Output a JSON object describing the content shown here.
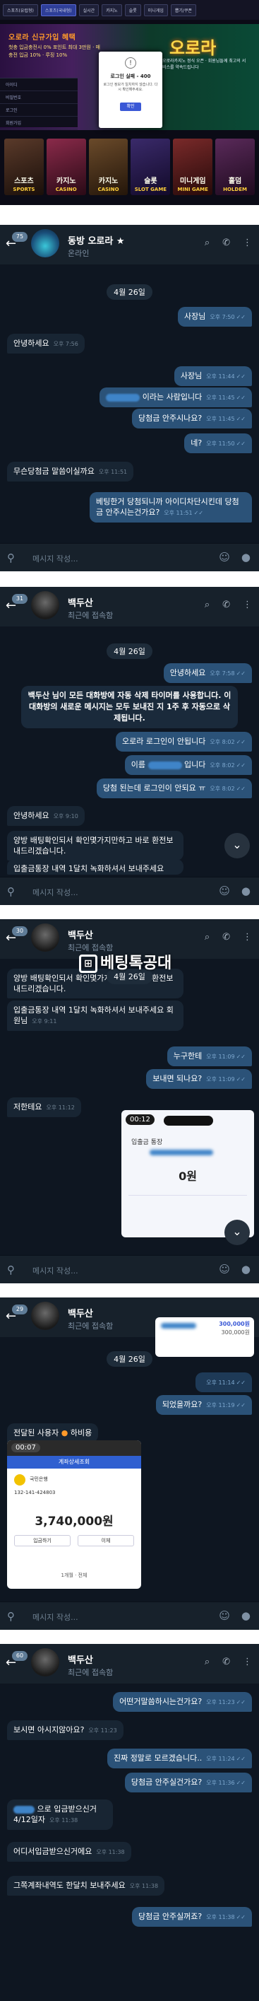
{
  "site": {
    "nav": [
      "스포츠(유럽형)",
      "스포츠(국내형)",
      "실시간",
      "카지노",
      "슬롯",
      "미니게임",
      "뽑기/쿠폰"
    ],
    "banner_title": "오로라 신규가입 혜택",
    "banner_sub": "첫충 입금충전시 0% 포인트 최대 3만원 · 매충전 입금 10% · 루징 10%",
    "brand": "오로라",
    "brand_sub": "오로라카지노 정식 오픈 · 회원님들께 최고의 서비스를 약속드립니다",
    "login_rows": [
      "아이디",
      "비밀번호",
      "로그인",
      "회원가입"
    ],
    "modal": {
      "icon": "!",
      "title": "로그인 실패 - 400",
      "body": "로그인 정보가 일치하지 않습니다. 다시 확인해주세요.",
      "ok": "확인"
    },
    "games": [
      {
        "name": "SPORTS",
        "sub": "스포츠"
      },
      {
        "name": "CASINO",
        "sub": "카지노"
      },
      {
        "name": "CASINO",
        "sub": "카지노"
      },
      {
        "name": "SLOT GAME",
        "sub": "슬롯"
      },
      {
        "name": "MINI GAME",
        "sub": "미니게임"
      },
      {
        "name": "HOLDEM",
        "sub": "홀덤"
      }
    ]
  },
  "panel1": {
    "badge": "75",
    "name": "동방 오로라 ★",
    "status": "온라인",
    "date": "4월 26일",
    "messages": [
      {
        "dir": "out",
        "text": "사장님",
        "time": "오후 7:50"
      },
      {
        "dir": "in",
        "text": "안녕하세요",
        "time": "오후 7:56"
      },
      {
        "dir": "out",
        "text": "사장님",
        "time": "오후 11:44"
      },
      {
        "dir": "out",
        "text": "이라는 사람입니다",
        "time": "오후 11:45"
      },
      {
        "dir": "out",
        "text": "당첨금 안주시나요?",
        "time": "오후 11:45"
      },
      {
        "dir": "out",
        "text": "네?",
        "time": "오후 11:50"
      },
      {
        "dir": "in",
        "text": "무슨당첨금 말씀이실까요",
        "time": "오후 11:51"
      },
      {
        "dir": "out",
        "text": "베팅한거 당첨되니까 아이디차단시킨데 당첨금 안주시는건가요?",
        "time": "오후 11:51"
      }
    ],
    "placeholder": "메시지 작성..."
  },
  "panel2": {
    "badge": "31",
    "name": "백두산",
    "status": "최근에 접속함",
    "date": "4월 26일",
    "sys": "백두산 님이 모든 대화방에 자동 삭제 타이머를 사용합니다. 이 대화방의 새로운 메시지는 모두 보내진 지 1주 후 자동으로 삭제됩니다.",
    "messages": [
      {
        "dir": "out",
        "text": "안녕하세요",
        "time": "오후 7:58"
      },
      {
        "dir": "out",
        "text": "오로라 로그인이 안됩니다",
        "time": "오후 8:02"
      },
      {
        "dir": "out",
        "text": "이름 입니다",
        "time": "오후 8:02"
      },
      {
        "dir": "out",
        "text": "당첨 된는데 로그인이 안되요 ㅠ",
        "time": "오후 8:02"
      },
      {
        "dir": "in",
        "text": "안녕하세요",
        "time": "오후 9:10"
      },
      {
        "dir": "in",
        "text": "양방 배팅확인되서 확인몇가지만하고 바로 환전보내드리겠습니다.",
        "time": ""
      },
      {
        "dir": "in",
        "text": "입출금통장 내역 1달치 녹화하셔서 보내주세요",
        "time": ""
      }
    ],
    "placeholder": "메시지 작성..."
  },
  "panel3": {
    "badge": "30",
    "name": "백두산",
    "status": "최근에 접속함",
    "date": "4월 26일",
    "watermark": "베팅톡공대",
    "messages": [
      {
        "dir": "in",
        "text": "양방 배팅확인되서 확인몇가지만하고 바로 환전보내드리겠습니다.",
        "time": ""
      },
      {
        "dir": "in",
        "text": "입출금통장 내역 1달치 녹화하셔서 보내주세요 회원님",
        "time": "오후 9:11"
      },
      {
        "dir": "out",
        "text": "누구한테",
        "time": "오후 11:09"
      },
      {
        "dir": "out",
        "text": "보내면 되나요?",
        "time": "오후 11:09"
      },
      {
        "dir": "in",
        "text": "저한테요",
        "time": "오후 11:12"
      }
    ],
    "video": {
      "time": "00:12",
      "bank": "입출금 통장",
      "amount": "0원"
    },
    "placeholder": "메시지 작성..."
  },
  "panel4": {
    "badge": "29",
    "name": "백두산",
    "status": "최근에 접속함",
    "date": "4월 26일",
    "top_amount": "300,000원",
    "top_amount2": "300,000원",
    "messages": [
      {
        "dir": "out",
        "text": "",
        "time": "오후 11:14"
      },
      {
        "dir": "out",
        "text": "되었을까요?",
        "time": "오후 11:19"
      }
    ],
    "forwarded": "전달된 사용자",
    "forwarded_from": "하비용",
    "video": {
      "time": "00:07",
      "title": "계좌상세조회",
      "bank": "국민은행",
      "account": "132-141-424803",
      "amount": "3,740,000원",
      "btn1": "입금하기",
      "btn2": "이체",
      "footer": "1개월 · 전체"
    },
    "placeholder": "메시지 작성..."
  },
  "panel5": {
    "badge": "60",
    "name": "백두산",
    "status": "최근에 접속함",
    "messages": [
      {
        "dir": "out",
        "text": "어떤거말씀하시는건가요?",
        "time": "오후 11:23"
      },
      {
        "dir": "in",
        "text": "보시면 아시지않아요?",
        "time": "오후 11:23"
      },
      {
        "dir": "out",
        "text": "진짜 정말로 모르겠습니다..",
        "time": "오후 11:24"
      },
      {
        "dir": "out",
        "text": "당첨금 안주실건가요?",
        "time": "오후 11:36"
      },
      {
        "dir": "in",
        "text": "으로 입금받으신거 4/12일자",
        "time": "오후 11:38"
      },
      {
        "dir": "in",
        "text": "어디서입금받으신거에요",
        "time": "오후 11:38"
      },
      {
        "dir": "in",
        "text": "그쪽계좌내역도 한달치 보내주세요",
        "time": "오후 11:38"
      },
      {
        "dir": "out",
        "text": "당첨금 안주실꺼죠?",
        "time": "오후 11:38"
      }
    ]
  },
  "icons": {
    "back": "←",
    "search": "⌕",
    "call": "✆",
    "more": "⋮",
    "clip": "⚲",
    "sticker": "☺",
    "mic": "●",
    "down": "⌄",
    "check": "✓✓"
  }
}
